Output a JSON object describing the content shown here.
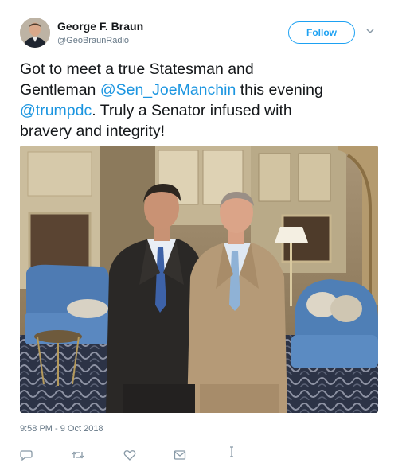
{
  "author": {
    "name": "George F. Braun",
    "handle": "@GeoBraunRadio"
  },
  "follow_button_label": "Follow",
  "tweet": {
    "line1": "Got to meet a true Statesman and",
    "line2_prefix": "Gentleman ",
    "mention1": "@Sen_JoeManchin",
    "line2_suffix": " this evening",
    "mention2": "@trumpdc",
    "line3_suffix": ". Truly a Senator infused with",
    "line4": "bravery and integrity!"
  },
  "timestamp": "9:58 PM - 9 Oct 2018",
  "icons": {
    "more": "chevron-down-icon",
    "actions": [
      "reply-icon",
      "retweet-icon",
      "like-icon",
      "direct-message-icon",
      "analytics-icon"
    ]
  },
  "colors": {
    "accent": "#1da1f2",
    "link": "#1b95e0",
    "muted": "#657786"
  }
}
